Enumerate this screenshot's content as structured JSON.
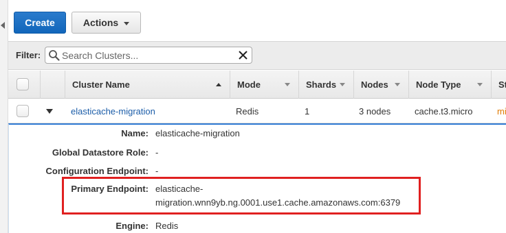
{
  "toolbar": {
    "create_label": "Create",
    "actions_label": "Actions"
  },
  "filter": {
    "label": "Filter:",
    "placeholder": "Search Clusters..."
  },
  "table": {
    "columns": [
      "Cluster Name",
      "Mode",
      "Shards",
      "Nodes",
      "Node Type",
      "St"
    ],
    "rows": [
      {
        "cluster_name": "elasticache-migration",
        "mode": "Redis",
        "shards": "1",
        "nodes": "3 nodes",
        "node_type": "cache.t3.micro",
        "status_partial": "mi"
      }
    ]
  },
  "details": {
    "name_label": "Name:",
    "name_value": "elasticache-migration",
    "global_label": "Global Datastore Role:",
    "global_value": "-",
    "config_label": "Configuration Endpoint:",
    "config_value": "-",
    "primary_label": "Primary Endpoint:",
    "primary_value_line1": "elasticache-",
    "primary_value_line2": "migration.wnn9yb.ng.0001.use1.cache.amazonaws.com:6379",
    "engine_label": "Engine:",
    "engine_value": "Redis"
  },
  "colors": {
    "primary_button": "#1166bb",
    "link": "#1a5ca8",
    "status_warning": "#e07b00",
    "highlight_box": "#e02020",
    "details_border": "#2f7ad4"
  },
  "icons": {
    "search": "search-icon",
    "clear": "close-icon",
    "dropdown": "chevron-down-icon",
    "expand": "caret-down-icon",
    "sort": "sort-arrow-icon"
  }
}
